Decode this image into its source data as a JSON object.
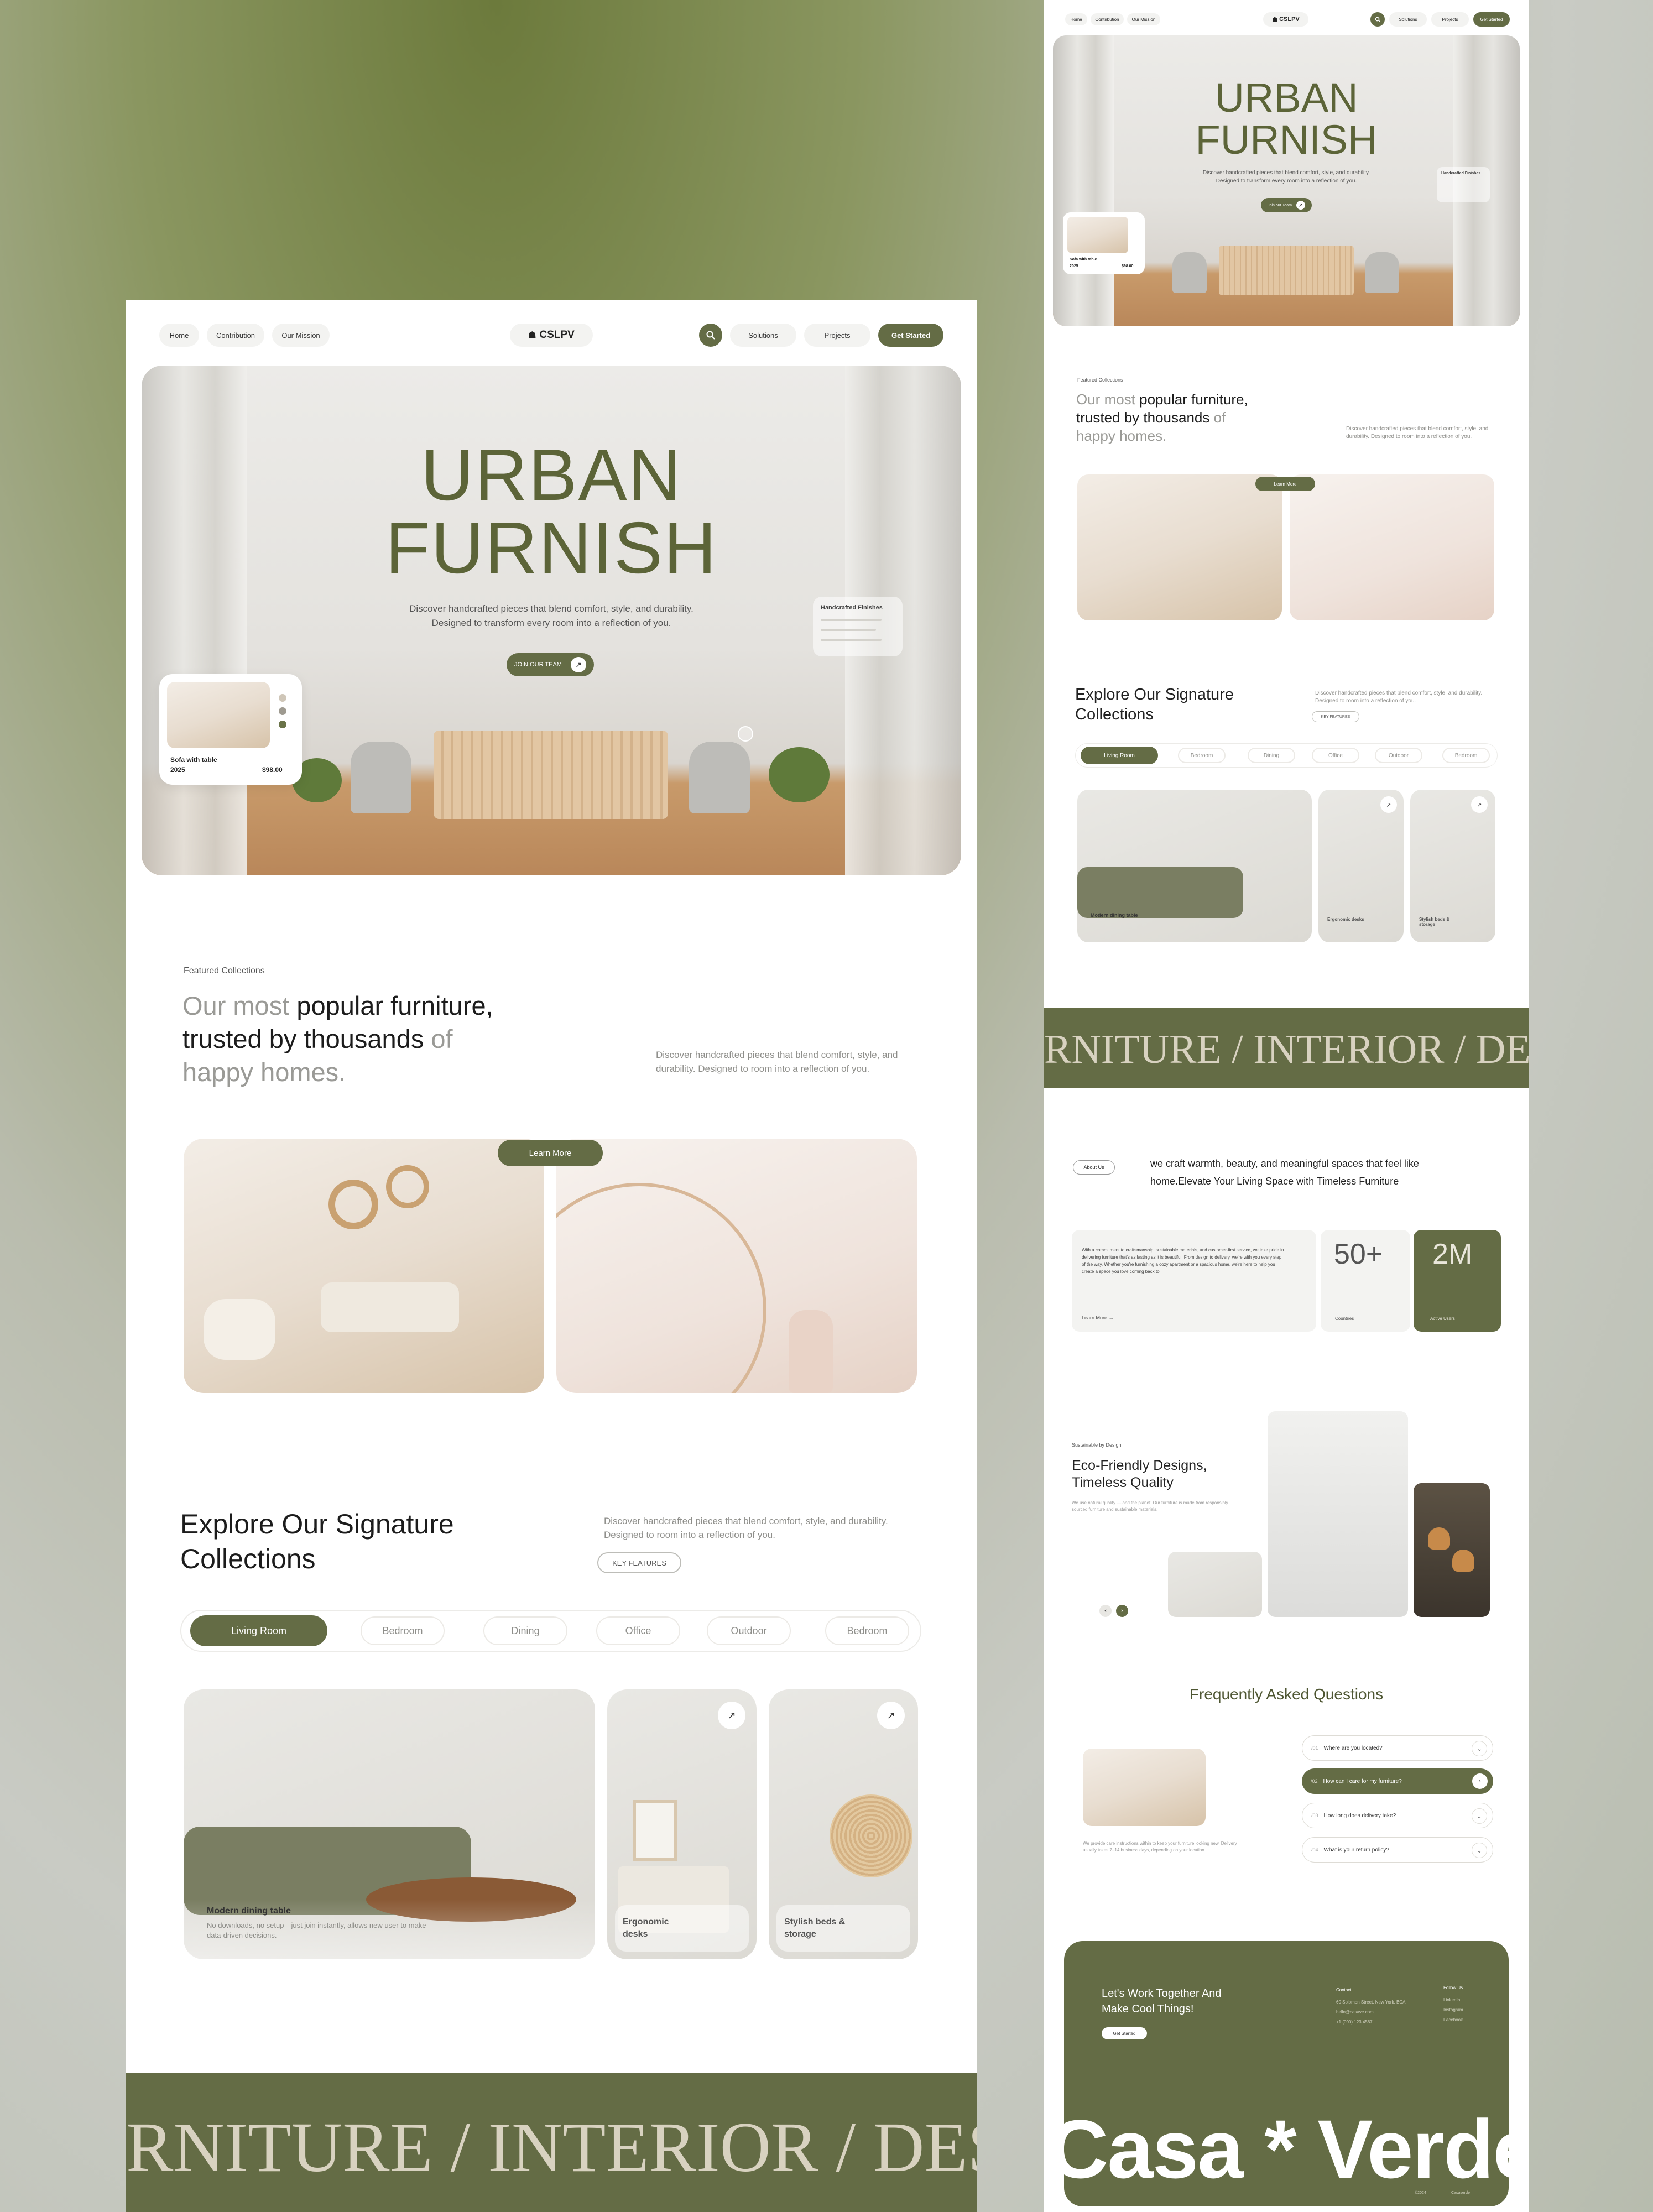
{
  "left": {
    "nav": {
      "links": [
        "Home",
        "Contribution",
        "Our Mission"
      ],
      "brand": "CSLPV",
      "right_links": [
        "Solutions",
        "Projects"
      ],
      "cta": "Get Started"
    },
    "hero": {
      "title_line1": "URBAN",
      "title_line2": "FURNISH",
      "subtitle_line1": "Discover handcrafted pieces that blend comfort, style, and durability.",
      "subtitle_line2": "Designed to transform every room into a reflection of you.",
      "cta": "JOIN OUR TEAM",
      "product_card": {
        "name": "Sofa with table",
        "year": "2025",
        "price": "$98.00"
      },
      "finishes_title": "Handcrafted Finishes"
    },
    "featured": {
      "kicker": "Featured Collections",
      "head_muted1": "Our most ",
      "head_bold1": "popular furniture,",
      "head_bold2": "trusted by thousands ",
      "head_muted2": "of",
      "head_muted3": "happy homes.",
      "desc_line1": "Discover handcrafted pieces that blend comfort, style, and",
      "desc_line2": "durability. Designed to room into a reflection of you.",
      "learn_more": "Learn More"
    },
    "collections": {
      "title_line1": "Explore Our Signature",
      "title_line2": "Collections",
      "desc_line1": "Discover handcrafted pieces that blend comfort, style, and durability.",
      "desc_line2": "Designed to room into a reflection of you.",
      "badge": "KEY FEATURES",
      "tabs": [
        "Living Room",
        "Bedroom",
        "Dining",
        "Office",
        "Outdoor",
        "Bedroom"
      ],
      "cards": [
        {
          "title": "Modern dining table",
          "desc": "No downloads, no setup—just join instantly, allows new user to make data-driven decisions."
        },
        {
          "title": "Ergonomic desks"
        },
        {
          "title": "Stylish beds & storage"
        }
      ]
    },
    "marquee": "RNITURE / INTERIOR / DESIG"
  },
  "right": {
    "nav": {
      "links": [
        "Home",
        "Contribution",
        "Our Mission"
      ],
      "brand": "CSLPV",
      "right_links": [
        "Solutions",
        "Projects"
      ],
      "cta": "Get Started"
    },
    "hero": {
      "title_line1": "URBAN",
      "title_line2": "FURNISH",
      "subtitle_line1": "Discover handcrafted pieces that blend comfort, style, and durability.",
      "subtitle_line2": "Designed to transform every room into a reflection of you.",
      "cta": "Join our Team",
      "finishes_title": "Handcrafted Finishes",
      "product_name": "Sofa with table",
      "product_year": "2025",
      "product_price": "$98.00"
    },
    "featured": {
      "kicker": "Featured Collections",
      "head_muted1": "Our most ",
      "head_bold1": "popular furniture,",
      "head_bold2": "trusted by thousands ",
      "head_muted2": "of",
      "head_muted3": "happy homes.",
      "desc_line1": "Discover handcrafted pieces that blend comfort, style, and",
      "desc_line2": "durability. Designed to room into a reflection of you.",
      "learn_more": "Learn More"
    },
    "collections": {
      "title_line1": "Explore Our Signature",
      "title_line2": "Collections",
      "desc_line1": "Discover handcrafted pieces that blend comfort, style, and durability.",
      "desc_line2": "Designed to room into a reflection of you.",
      "badge": "KEY FEATURES",
      "tabs": [
        "Living Room",
        "Bedroom",
        "Dining",
        "Office",
        "Outdoor",
        "Bedroom"
      ],
      "cards": [
        "Modern dining table",
        "Ergonomic desks",
        "Stylish beds & storage"
      ]
    },
    "marquee": "RNITURE / INTERIOR / DESIG",
    "about": {
      "badge": "About Us",
      "statement_line1": "we craft warmth, beauty, and meaningful spaces that feel like",
      "statement_line2": "home.Elevate Your Living Space with Timeless Furniture",
      "body": "With a commitment to craftsmanship, sustainable materials, and customer-first service, we take pride in delivering furniture that's as lasting as it is beautiful. From design to delivery, we're with you every step of the way. Whether you're furnishing a cozy apartment or a spacious home, we're here to help you create a space you love coming back to.",
      "learn_more": "Learn More",
      "stat1_value": "50+",
      "stat1_label": "Countries",
      "stat2_value": "2M",
      "stat2_label": "Active Users"
    },
    "eco": {
      "kicker": "Sustainable by Design",
      "title_line1": "Eco-Friendly Designs,",
      "title_line2": "Timeless Quality",
      "desc": "We use natural quality — and the planet. Our furniture is made from responsibly sourced furniture and sustainable materials."
    },
    "faq": {
      "title": "Frequently Asked Questions",
      "note": "We provide care instructions within to keep your furniture looking new. Delivery usually takes 7–14 business days, depending on your location.",
      "items": [
        {
          "num": "/01",
          "q": "Where are you located?"
        },
        {
          "num": "/02",
          "q": "How can I care for my furniture?"
        },
        {
          "num": "/03",
          "q": "How long does delivery take?"
        },
        {
          "num": "/04",
          "q": "What is your return policy?"
        }
      ]
    },
    "footer": {
      "headline_line1": "Let's Work Together And",
      "headline_line2": "Make Cool Things!",
      "cta": "Get Started",
      "contact_title": "Contact",
      "contact_lines": [
        "60 Solomon Street, New York, BCA",
        "hello@casave.com",
        "+1 (000) 123 4567"
      ],
      "follow_title": "Follow Us",
      "follow_links": [
        "LinkedIn",
        "Instagram",
        "Facebook"
      ],
      "brand": "Casa * Verdet",
      "copyright": "©2024",
      "rights": "Casaverde"
    }
  },
  "colors": {
    "olive": "#646c45",
    "olive_dark": "#555c37",
    "cream": "#d8d2c0"
  }
}
